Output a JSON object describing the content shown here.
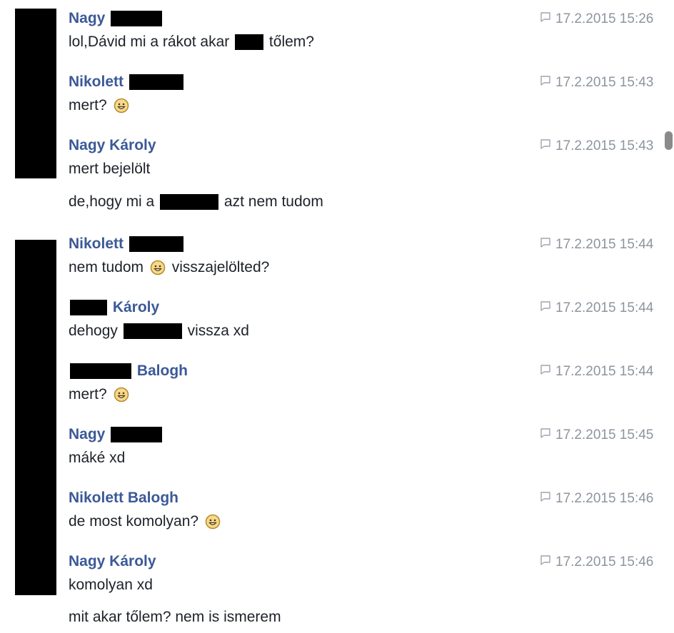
{
  "messages": [
    {
      "time": "17.2.2015 15:26",
      "name_parts": [
        "Nagy ",
        {
          "redact": 72
        }
      ],
      "text_parts": [
        "lol,Dávid mi a rákot akar ",
        {
          "redact": 40
        },
        " tőlem?"
      ]
    },
    {
      "time": "17.2.2015 15:43",
      "name_parts": [
        "Nikolett ",
        {
          "redact": 76
        }
      ],
      "text_parts": [
        "mert? ",
        {
          "emoji": "smiley"
        }
      ]
    },
    {
      "time": "17.2.2015 15:43",
      "name_parts": [
        "Nagy Károly"
      ],
      "text_parts": [
        "mert bejelölt"
      ]
    },
    {
      "time": "17.2.2015 15:44",
      "name_parts": [
        "Nikolett ",
        {
          "redact": 76
        }
      ],
      "text_parts": [
        "nem tudom ",
        {
          "emoji": "smiley"
        },
        " visszajelölted?"
      ]
    },
    {
      "time": "17.2.2015 15:44",
      "name_parts": [
        {
          "redact": 52
        },
        " Károly"
      ],
      "text_parts": [
        "dehogy ",
        {
          "redact": 82
        },
        " vissza xd"
      ]
    },
    {
      "time": "17.2.2015 15:44",
      "name_parts": [
        {
          "redact": 86
        },
        " Balogh"
      ],
      "text_parts": [
        "mert? ",
        {
          "emoji": "smiley"
        }
      ]
    },
    {
      "time": "17.2.2015 15:45",
      "name_parts": [
        "Nagy ",
        {
          "redact": 72
        }
      ],
      "text_parts": [
        "máké xd"
      ]
    },
    {
      "time": "17.2.2015 15:46",
      "name_parts": [
        "Nikolett Balogh"
      ],
      "text_parts": [
        "de most komolyan? ",
        {
          "emoji": "smiley"
        }
      ]
    },
    {
      "time": "17.2.2015 15:46",
      "name_parts": [
        "Nagy Károly"
      ],
      "text_parts": [
        "komolyan xd"
      ]
    }
  ],
  "extra_lines": [
    {
      "after": 2,
      "text_parts": [
        "de,hogy mi a ",
        {
          "redact": 82
        },
        " azt nem tudom"
      ]
    },
    {
      "after": 8,
      "text_parts": [
        "mit akar tőlem? nem is ismerem"
      ]
    }
  ],
  "colors": {
    "name": "#3b5998",
    "text": "#1d2129",
    "time": "#8d949e",
    "redaction": "#000000"
  },
  "icons": {
    "timestamp": "comment-bubble-icon",
    "emoji": "smiley-emoji-icon"
  }
}
